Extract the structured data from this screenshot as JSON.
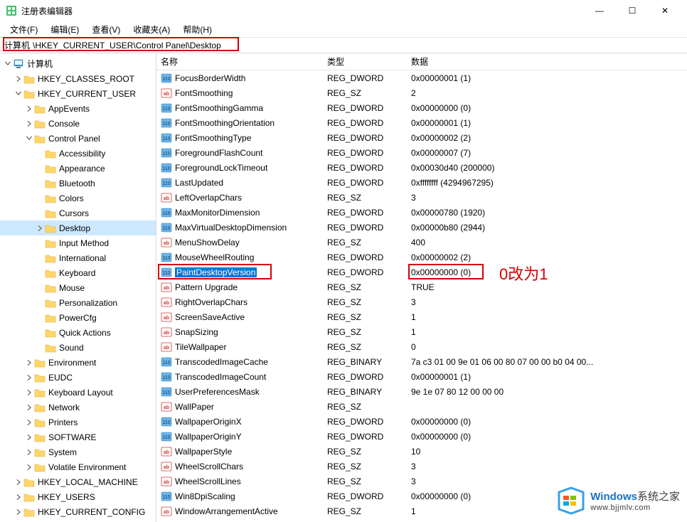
{
  "window": {
    "title": "注册表编辑器",
    "controls": {
      "min": "—",
      "max": "☐",
      "close": "✕"
    }
  },
  "menu": {
    "file": "文件(F)",
    "edit": "编辑(E)",
    "view": "查看(V)",
    "favorites": "收藏夹(A)",
    "help": "帮助(H)"
  },
  "address": {
    "label": "计算机",
    "path": "\\HKEY_CURRENT_USER\\Control Panel\\Desktop"
  },
  "tree": {
    "root": "计算机",
    "hives": [
      {
        "name": "HKEY_CLASSES_ROOT",
        "expanded": false
      },
      {
        "name": "HKEY_CURRENT_USER",
        "expanded": true,
        "children": [
          {
            "name": "AppEvents"
          },
          {
            "name": "Console"
          },
          {
            "name": "Control Panel",
            "expanded": true,
            "children": [
              {
                "name": "Accessibility"
              },
              {
                "name": "Appearance"
              },
              {
                "name": "Bluetooth"
              },
              {
                "name": "Colors"
              },
              {
                "name": "Cursors"
              },
              {
                "name": "Desktop",
                "selected": true,
                "expandable": true
              },
              {
                "name": "Input Method"
              },
              {
                "name": "International"
              },
              {
                "name": "Keyboard"
              },
              {
                "name": "Mouse"
              },
              {
                "name": "Personalization"
              },
              {
                "name": "PowerCfg"
              },
              {
                "name": "Quick Actions"
              },
              {
                "name": "Sound"
              }
            ]
          },
          {
            "name": "Environment"
          },
          {
            "name": "EUDC"
          },
          {
            "name": "Keyboard Layout"
          },
          {
            "name": "Network"
          },
          {
            "name": "Printers"
          },
          {
            "name": "SOFTWARE"
          },
          {
            "name": "System"
          },
          {
            "name": "Volatile Environment"
          }
        ]
      },
      {
        "name": "HKEY_LOCAL_MACHINE",
        "expanded": false
      },
      {
        "name": "HKEY_USERS",
        "expanded": false
      },
      {
        "name": "HKEY_CURRENT_CONFIG",
        "expanded": false
      }
    ]
  },
  "list": {
    "headers": {
      "name": "名称",
      "type": "类型",
      "data": "数据"
    },
    "rows": [
      {
        "icon": "bin",
        "name": "FocusBorderWidth",
        "type": "REG_DWORD",
        "data": "0x00000001 (1)"
      },
      {
        "icon": "str",
        "name": "FontSmoothing",
        "type": "REG_SZ",
        "data": "2"
      },
      {
        "icon": "bin",
        "name": "FontSmoothingGamma",
        "type": "REG_DWORD",
        "data": "0x00000000 (0)"
      },
      {
        "icon": "bin",
        "name": "FontSmoothingOrientation",
        "type": "REG_DWORD",
        "data": "0x00000001 (1)"
      },
      {
        "icon": "bin",
        "name": "FontSmoothingType",
        "type": "REG_DWORD",
        "data": "0x00000002 (2)"
      },
      {
        "icon": "bin",
        "name": "ForegroundFlashCount",
        "type": "REG_DWORD",
        "data": "0x00000007 (7)"
      },
      {
        "icon": "bin",
        "name": "ForegroundLockTimeout",
        "type": "REG_DWORD",
        "data": "0x00030d40 (200000)"
      },
      {
        "icon": "bin",
        "name": "LastUpdated",
        "type": "REG_DWORD",
        "data": "0xffffffff (4294967295)"
      },
      {
        "icon": "str",
        "name": "LeftOverlapChars",
        "type": "REG_SZ",
        "data": "3"
      },
      {
        "icon": "bin",
        "name": "MaxMonitorDimension",
        "type": "REG_DWORD",
        "data": "0x00000780 (1920)"
      },
      {
        "icon": "bin",
        "name": "MaxVirtualDesktopDimension",
        "type": "REG_DWORD",
        "data": "0x00000b80 (2944)"
      },
      {
        "icon": "str",
        "name": "MenuShowDelay",
        "type": "REG_SZ",
        "data": "400"
      },
      {
        "icon": "bin",
        "name": "MouseWheelRouting",
        "type": "REG_DWORD",
        "data": "0x00000002 (2)"
      },
      {
        "icon": "bin",
        "name": "PaintDesktopVersion",
        "type": "REG_DWORD",
        "data": "0x00000000 (0)",
        "selected": true
      },
      {
        "icon": "str",
        "name": "Pattern Upgrade",
        "type": "REG_SZ",
        "data": "TRUE"
      },
      {
        "icon": "str",
        "name": "RightOverlapChars",
        "type": "REG_SZ",
        "data": "3"
      },
      {
        "icon": "str",
        "name": "ScreenSaveActive",
        "type": "REG_SZ",
        "data": "1"
      },
      {
        "icon": "str",
        "name": "SnapSizing",
        "type": "REG_SZ",
        "data": "1"
      },
      {
        "icon": "str",
        "name": "TileWallpaper",
        "type": "REG_SZ",
        "data": "0"
      },
      {
        "icon": "bin",
        "name": "TranscodedImageCache",
        "type": "REG_BINARY",
        "data": "7a c3 01 00 9e 01 06 00 80 07 00 00 b0 04 00..."
      },
      {
        "icon": "bin",
        "name": "TranscodedImageCount",
        "type": "REG_DWORD",
        "data": "0x00000001 (1)"
      },
      {
        "icon": "bin",
        "name": "UserPreferencesMask",
        "type": "REG_BINARY",
        "data": "9e 1e 07 80 12 00 00 00"
      },
      {
        "icon": "str",
        "name": "WallPaper",
        "type": "REG_SZ",
        "data": ""
      },
      {
        "icon": "bin",
        "name": "WallpaperOriginX",
        "type": "REG_DWORD",
        "data": "0x00000000 (0)"
      },
      {
        "icon": "bin",
        "name": "WallpaperOriginY",
        "type": "REG_DWORD",
        "data": "0x00000000 (0)"
      },
      {
        "icon": "str",
        "name": "WallpaperStyle",
        "type": "REG_SZ",
        "data": "10"
      },
      {
        "icon": "str",
        "name": "WheelScrollChars",
        "type": "REG_SZ",
        "data": "3"
      },
      {
        "icon": "str",
        "name": "WheelScrollLines",
        "type": "REG_SZ",
        "data": "3"
      },
      {
        "icon": "bin",
        "name": "Win8DpiScaling",
        "type": "REG_DWORD",
        "data": "0x00000000 (0)"
      },
      {
        "icon": "str",
        "name": "WindowArrangementActive",
        "type": "REG_SZ",
        "data": "1"
      }
    ]
  },
  "annotation": {
    "text": "0改为1"
  },
  "watermark": {
    "line1a": "Windows",
    "line1b": "系统之家",
    "line2": "www.bjjmlv.com"
  }
}
